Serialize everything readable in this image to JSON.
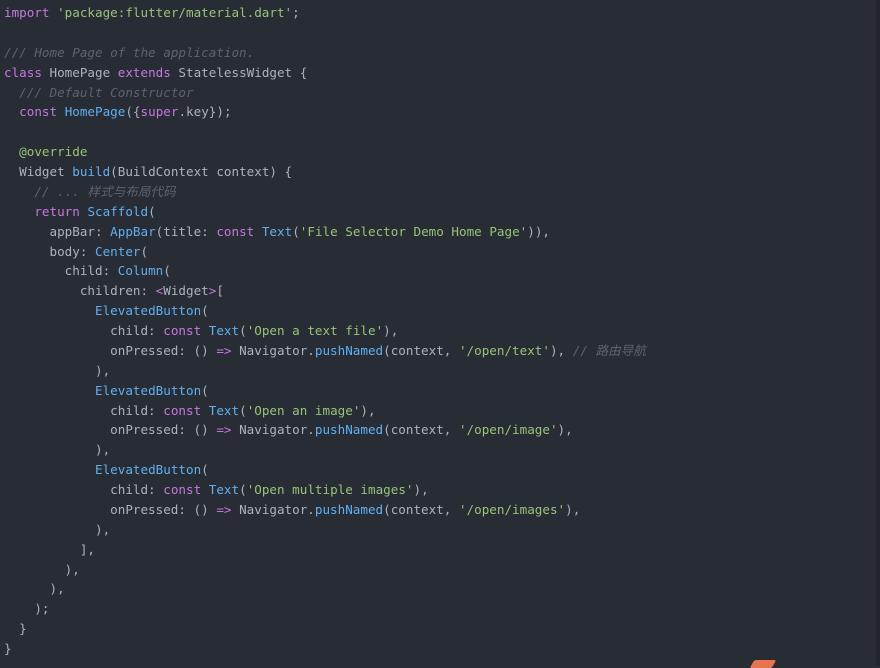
{
  "colors": {
    "background": "#282c34",
    "keyword": "#c678dd",
    "string": "#98c379",
    "comment": "#5c6370",
    "function": "#61afef",
    "plain": "#abb2bf",
    "annotation": "#98c379"
  },
  "code_lines": [
    [
      [
        "kw",
        "import"
      ],
      [
        "pn",
        " "
      ],
      [
        "str",
        "'package:flutter/material.dart'"
      ],
      [
        "pn",
        ";"
      ]
    ],
    [],
    [
      [
        "cm",
        "/// Home Page of the application."
      ]
    ],
    [
      [
        "kw",
        "class"
      ],
      [
        "ty",
        " HomePage "
      ],
      [
        "kw",
        "extends"
      ],
      [
        "ty",
        " StatelessWidget "
      ],
      [
        "pn",
        "{"
      ]
    ],
    [
      [
        "pn",
        "  "
      ],
      [
        "cm",
        "/// Default Constructor"
      ]
    ],
    [
      [
        "pn",
        "  "
      ],
      [
        "kw",
        "const"
      ],
      [
        "pn",
        " "
      ],
      [
        "fn",
        "HomePage"
      ],
      [
        "pn",
        "({"
      ],
      [
        "kw",
        "super"
      ],
      [
        "pn",
        ".key});"
      ]
    ],
    [],
    [
      [
        "pn",
        "  "
      ],
      [
        "an",
        "@override"
      ]
    ],
    [
      [
        "pn",
        "  Widget "
      ],
      [
        "fn",
        "build"
      ],
      [
        "pn",
        "(BuildContext context) {"
      ]
    ],
    [
      [
        "pn",
        "    "
      ],
      [
        "cm",
        "// ... 样式与布局代码"
      ]
    ],
    [
      [
        "pn",
        "    "
      ],
      [
        "kw",
        "return"
      ],
      [
        "pn",
        " "
      ],
      [
        "fn",
        "Scaffold"
      ],
      [
        "pn",
        "("
      ]
    ],
    [
      [
        "pn",
        "      appBar: "
      ],
      [
        "fn",
        "AppBar"
      ],
      [
        "pn",
        "(title: "
      ],
      [
        "kw",
        "const"
      ],
      [
        "pn",
        " "
      ],
      [
        "fn",
        "Text"
      ],
      [
        "pn",
        "("
      ],
      [
        "str",
        "'File Selector Demo Home Page'"
      ],
      [
        "pn",
        ")),"
      ]
    ],
    [
      [
        "pn",
        "      body: "
      ],
      [
        "fn",
        "Center"
      ],
      [
        "pn",
        "("
      ]
    ],
    [
      [
        "pn",
        "        child: "
      ],
      [
        "fn",
        "Column"
      ],
      [
        "pn",
        "("
      ]
    ],
    [
      [
        "pn",
        "          children: "
      ],
      [
        "op",
        "<"
      ],
      [
        "pn",
        "Widget"
      ],
      [
        "op",
        ">"
      ],
      [
        "pn",
        "["
      ]
    ],
    [
      [
        "pn",
        "            "
      ],
      [
        "fn",
        "ElevatedButton"
      ],
      [
        "pn",
        "("
      ]
    ],
    [
      [
        "pn",
        "              child: "
      ],
      [
        "kw",
        "const"
      ],
      [
        "pn",
        " "
      ],
      [
        "fn",
        "Text"
      ],
      [
        "pn",
        "("
      ],
      [
        "str",
        "'Open a text file'"
      ],
      [
        "pn",
        "),"
      ]
    ],
    [
      [
        "pn",
        "              onPressed: () "
      ],
      [
        "op",
        "=>"
      ],
      [
        "pn",
        " Navigator."
      ],
      [
        "fn",
        "pushNamed"
      ],
      [
        "pn",
        "(context, "
      ],
      [
        "str",
        "'/open/text'"
      ],
      [
        "pn",
        "), "
      ],
      [
        "cm",
        "// 路由导航"
      ]
    ],
    [
      [
        "pn",
        "            ),"
      ]
    ],
    [
      [
        "pn",
        "            "
      ],
      [
        "fn",
        "ElevatedButton"
      ],
      [
        "pn",
        "("
      ]
    ],
    [
      [
        "pn",
        "              child: "
      ],
      [
        "kw",
        "const"
      ],
      [
        "pn",
        " "
      ],
      [
        "fn",
        "Text"
      ],
      [
        "pn",
        "("
      ],
      [
        "str",
        "'Open an image'"
      ],
      [
        "pn",
        "),"
      ]
    ],
    [
      [
        "pn",
        "              onPressed: () "
      ],
      [
        "op",
        "=>"
      ],
      [
        "pn",
        " Navigator."
      ],
      [
        "fn",
        "pushNamed"
      ],
      [
        "pn",
        "(context, "
      ],
      [
        "str",
        "'/open/image'"
      ],
      [
        "pn",
        "),"
      ]
    ],
    [
      [
        "pn",
        "            ),"
      ]
    ],
    [
      [
        "pn",
        "            "
      ],
      [
        "fn",
        "ElevatedButton"
      ],
      [
        "pn",
        "("
      ]
    ],
    [
      [
        "pn",
        "              child: "
      ],
      [
        "kw",
        "const"
      ],
      [
        "pn",
        " "
      ],
      [
        "fn",
        "Text"
      ],
      [
        "pn",
        "("
      ],
      [
        "str",
        "'Open multiple images'"
      ],
      [
        "pn",
        "),"
      ]
    ],
    [
      [
        "pn",
        "              onPressed: () "
      ],
      [
        "op",
        "=>"
      ],
      [
        "pn",
        " Navigator."
      ],
      [
        "fn",
        "pushNamed"
      ],
      [
        "pn",
        "(context, "
      ],
      [
        "str",
        "'/open/images'"
      ],
      [
        "pn",
        "),"
      ]
    ],
    [
      [
        "pn",
        "            ),"
      ]
    ],
    [
      [
        "pn",
        "          ],"
      ]
    ],
    [
      [
        "pn",
        "        ),"
      ]
    ],
    [
      [
        "pn",
        "      ),"
      ]
    ],
    [
      [
        "pn",
        "    );"
      ]
    ],
    [
      [
        "pn",
        "  }"
      ]
    ],
    [
      [
        "pn",
        "}"
      ]
    ]
  ]
}
